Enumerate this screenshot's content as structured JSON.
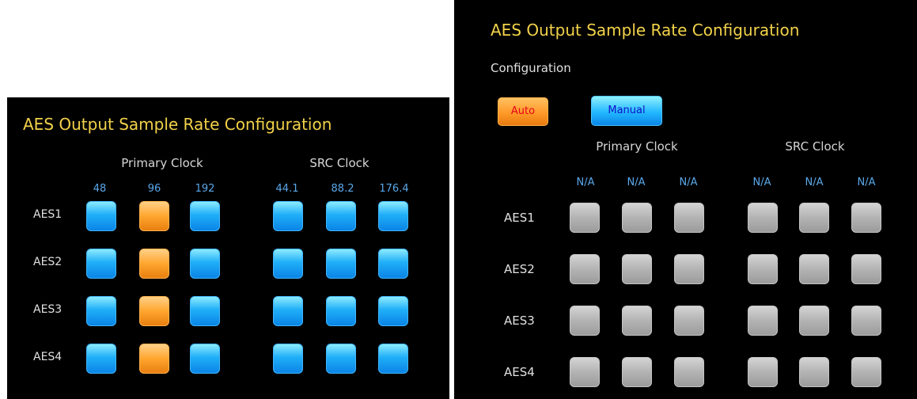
{
  "left_panel": {
    "title": "AES Output Sample Rate Configuration",
    "group_primary": "Primary Clock",
    "group_src": "SRC Clock",
    "columns": [
      "48",
      "96",
      "192",
      "44.1",
      "88.2",
      "176.4"
    ],
    "rows": [
      "AES1",
      "AES2",
      "AES3",
      "AES4"
    ],
    "selected_column": "96",
    "colors": {
      "selected": "#ffa62e",
      "unselected": "#20aff8",
      "title": "#f2d24a"
    }
  },
  "right_panel": {
    "title": "AES Output Sample Rate Configuration",
    "config_label": "Configuration",
    "auto_label": "Auto",
    "manual_label": "Manual",
    "group_primary": "Primary Clock",
    "group_src": "SRC Clock",
    "columns": [
      "N/A",
      "N/A",
      "N/A",
      "N/A",
      "N/A",
      "N/A"
    ],
    "rows": [
      "AES1",
      "AES2",
      "AES3",
      "AES4"
    ],
    "colors": {
      "disabled": "#b3b3b3",
      "auto": "#ff9a28",
      "manual": "#22b8ff"
    }
  }
}
